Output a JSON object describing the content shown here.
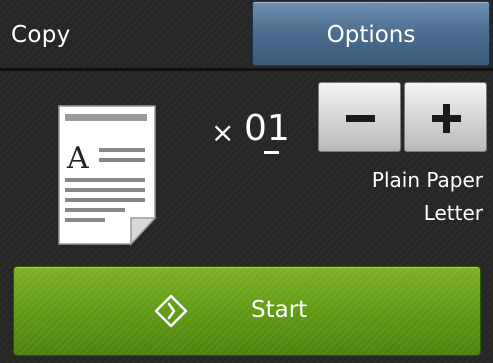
{
  "header": {
    "title": "Copy",
    "options_label": "Options"
  },
  "copies": {
    "multiplier": "×",
    "count": "01"
  },
  "stepper": {
    "minus_icon": "minus-icon",
    "plus_icon": "plus-icon"
  },
  "paper": {
    "type": "Plain Paper",
    "size": "Letter"
  },
  "document_icon": {
    "letter": "A"
  },
  "start": {
    "label": "Start",
    "icon": "start-diamond-icon"
  },
  "colors": {
    "options_blue": "#4d6f91",
    "start_green": "#5f9a14",
    "background": "#262626"
  }
}
